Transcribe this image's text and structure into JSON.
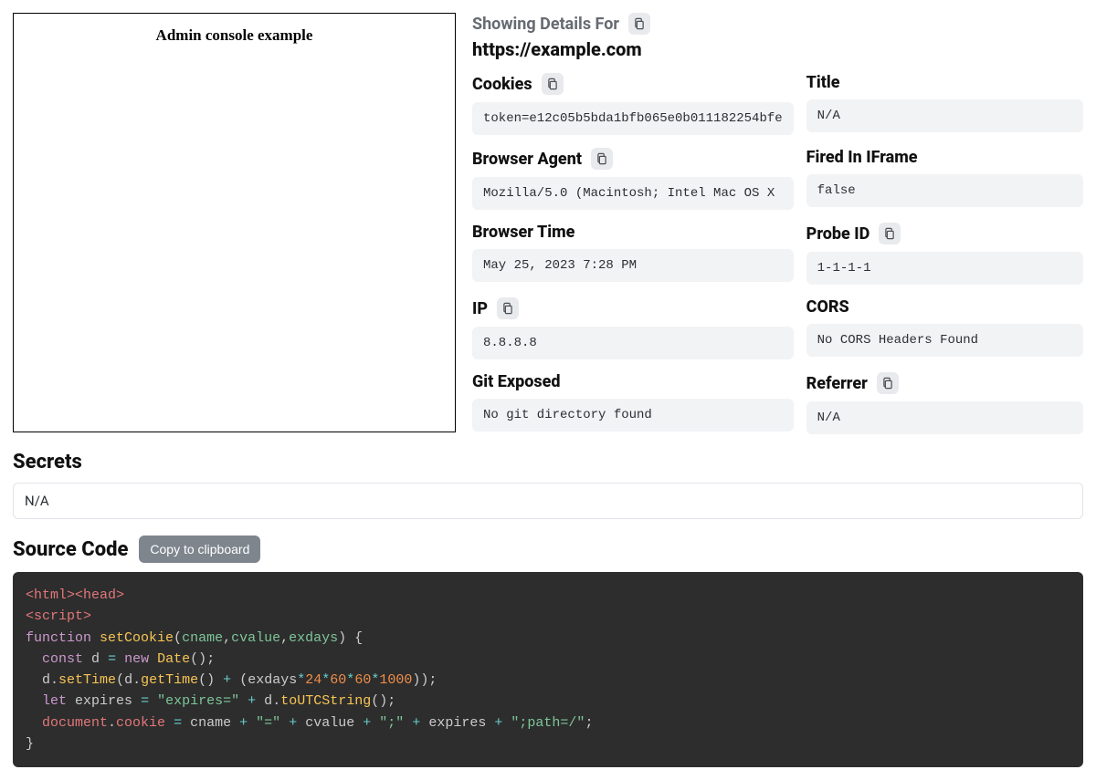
{
  "screenshot": {
    "title": "Admin console example"
  },
  "details": {
    "heading": "Showing Details For",
    "url": "https://example.com",
    "fields": {
      "cookies": {
        "label": "Cookies",
        "value": "token=e12c05b5bda1bfb065e0b011182254bfe",
        "copy": true
      },
      "title": {
        "label": "Title",
        "value": "N/A",
        "copy": false
      },
      "browser_agent": {
        "label": "Browser Agent",
        "value": "Mozilla/5.0 (Macintosh; Intel Mac OS X",
        "copy": true
      },
      "fired_iframe": {
        "label": "Fired In IFrame",
        "value": "false",
        "copy": false
      },
      "browser_time": {
        "label": "Browser Time",
        "value": "May 25, 2023 7:28 PM",
        "copy": false
      },
      "probe_id": {
        "label": "Probe ID",
        "value": "1-1-1-1",
        "copy": true
      },
      "ip": {
        "label": "IP",
        "value": "8.8.8.8",
        "copy": true
      },
      "cors": {
        "label": "CORS",
        "value": "No CORS Headers Found",
        "copy": false
      },
      "git_exposed": {
        "label": "Git Exposed",
        "value": "No git directory found",
        "copy": false
      },
      "referrer": {
        "label": "Referrer",
        "value": "N/A",
        "copy": true
      }
    }
  },
  "secrets": {
    "heading": "Secrets",
    "value": "N/A"
  },
  "source_code": {
    "heading": "Source Code",
    "copy_button": "Copy to clipboard",
    "tokens": [
      [
        "tag",
        "<html>"
      ],
      [
        "tag",
        "<head>"
      ],
      [
        "nl",
        ""
      ],
      [
        "tag",
        "<script>"
      ],
      [
        "nl",
        ""
      ],
      [
        "kw",
        "function"
      ],
      [
        "sp",
        " "
      ],
      [
        "fn",
        "setCookie"
      ],
      [
        "punct",
        "("
      ],
      [
        "param",
        "cname"
      ],
      [
        "punct",
        ","
      ],
      [
        "param",
        "cvalue"
      ],
      [
        "punct",
        ","
      ],
      [
        "param",
        "exdays"
      ],
      [
        "punct",
        ")"
      ],
      [
        "sp",
        " "
      ],
      [
        "punct",
        "{"
      ],
      [
        "nl",
        ""
      ],
      [
        "sp",
        "  "
      ],
      [
        "kw",
        "const"
      ],
      [
        "sp",
        " "
      ],
      [
        "ident",
        "d"
      ],
      [
        "sp",
        " "
      ],
      [
        "op",
        "="
      ],
      [
        "sp",
        " "
      ],
      [
        "kw",
        "new"
      ],
      [
        "sp",
        " "
      ],
      [
        "fn",
        "Date"
      ],
      [
        "punct",
        "("
      ],
      [
        "punct",
        ")"
      ],
      [
        "punct",
        ";"
      ],
      [
        "nl",
        ""
      ],
      [
        "sp",
        "  "
      ],
      [
        "ident",
        "d"
      ],
      [
        "punct",
        "."
      ],
      [
        "fn",
        "setTime"
      ],
      [
        "punct",
        "("
      ],
      [
        "ident",
        "d"
      ],
      [
        "punct",
        "."
      ],
      [
        "fn",
        "getTime"
      ],
      [
        "punct",
        "("
      ],
      [
        "punct",
        ")"
      ],
      [
        "sp",
        " "
      ],
      [
        "op",
        "+"
      ],
      [
        "sp",
        " "
      ],
      [
        "punct",
        "("
      ],
      [
        "ident",
        "exdays"
      ],
      [
        "op",
        "*"
      ],
      [
        "num",
        "24"
      ],
      [
        "op",
        "*"
      ],
      [
        "num",
        "60"
      ],
      [
        "op",
        "*"
      ],
      [
        "num",
        "60"
      ],
      [
        "op",
        "*"
      ],
      [
        "num",
        "1000"
      ],
      [
        "punct",
        ")"
      ],
      [
        "punct",
        ")"
      ],
      [
        "punct",
        ";"
      ],
      [
        "nl",
        ""
      ],
      [
        "sp",
        "  "
      ],
      [
        "kw",
        "let"
      ],
      [
        "sp",
        " "
      ],
      [
        "ident",
        "expires"
      ],
      [
        "sp",
        " "
      ],
      [
        "op",
        "="
      ],
      [
        "sp",
        " "
      ],
      [
        "str",
        "\"expires=\""
      ],
      [
        "sp",
        " "
      ],
      [
        "op",
        "+"
      ],
      [
        "sp",
        " "
      ],
      [
        "ident",
        "d"
      ],
      [
        "punct",
        "."
      ],
      [
        "fn",
        "toUTCString"
      ],
      [
        "punct",
        "("
      ],
      [
        "punct",
        ")"
      ],
      [
        "punct",
        ";"
      ],
      [
        "nl",
        ""
      ],
      [
        "sp",
        "  "
      ],
      [
        "dom",
        "document"
      ],
      [
        "punct",
        "."
      ],
      [
        "var",
        "cookie"
      ],
      [
        "sp",
        " "
      ],
      [
        "op",
        "="
      ],
      [
        "sp",
        " "
      ],
      [
        "ident",
        "cname"
      ],
      [
        "sp",
        " "
      ],
      [
        "op",
        "+"
      ],
      [
        "sp",
        " "
      ],
      [
        "str",
        "\"=\""
      ],
      [
        "sp",
        " "
      ],
      [
        "op",
        "+"
      ],
      [
        "sp",
        " "
      ],
      [
        "ident",
        "cvalue"
      ],
      [
        "sp",
        " "
      ],
      [
        "op",
        "+"
      ],
      [
        "sp",
        " "
      ],
      [
        "str",
        "\";\""
      ],
      [
        "sp",
        " "
      ],
      [
        "op",
        "+"
      ],
      [
        "sp",
        " "
      ],
      [
        "ident",
        "expires"
      ],
      [
        "sp",
        " "
      ],
      [
        "op",
        "+"
      ],
      [
        "sp",
        " "
      ],
      [
        "str",
        "\";path=/\""
      ],
      [
        "punct",
        ";"
      ],
      [
        "nl",
        ""
      ],
      [
        "punct",
        "}"
      ]
    ]
  }
}
